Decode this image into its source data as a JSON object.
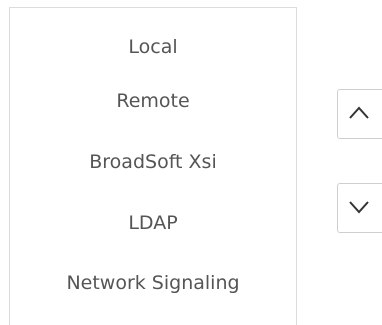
{
  "list": {
    "items": [
      {
        "label": "Local"
      },
      {
        "label": "Remote"
      },
      {
        "label": "BroadSoft Xsi"
      },
      {
        "label": "LDAP"
      },
      {
        "label": "Network Signaling"
      }
    ]
  },
  "controls": {
    "move_up_icon": "chevron-up-icon",
    "move_down_icon": "chevron-down-icon"
  },
  "colors": {
    "text": "#555555",
    "border": "#dcdcdc",
    "icon": "#333333"
  }
}
